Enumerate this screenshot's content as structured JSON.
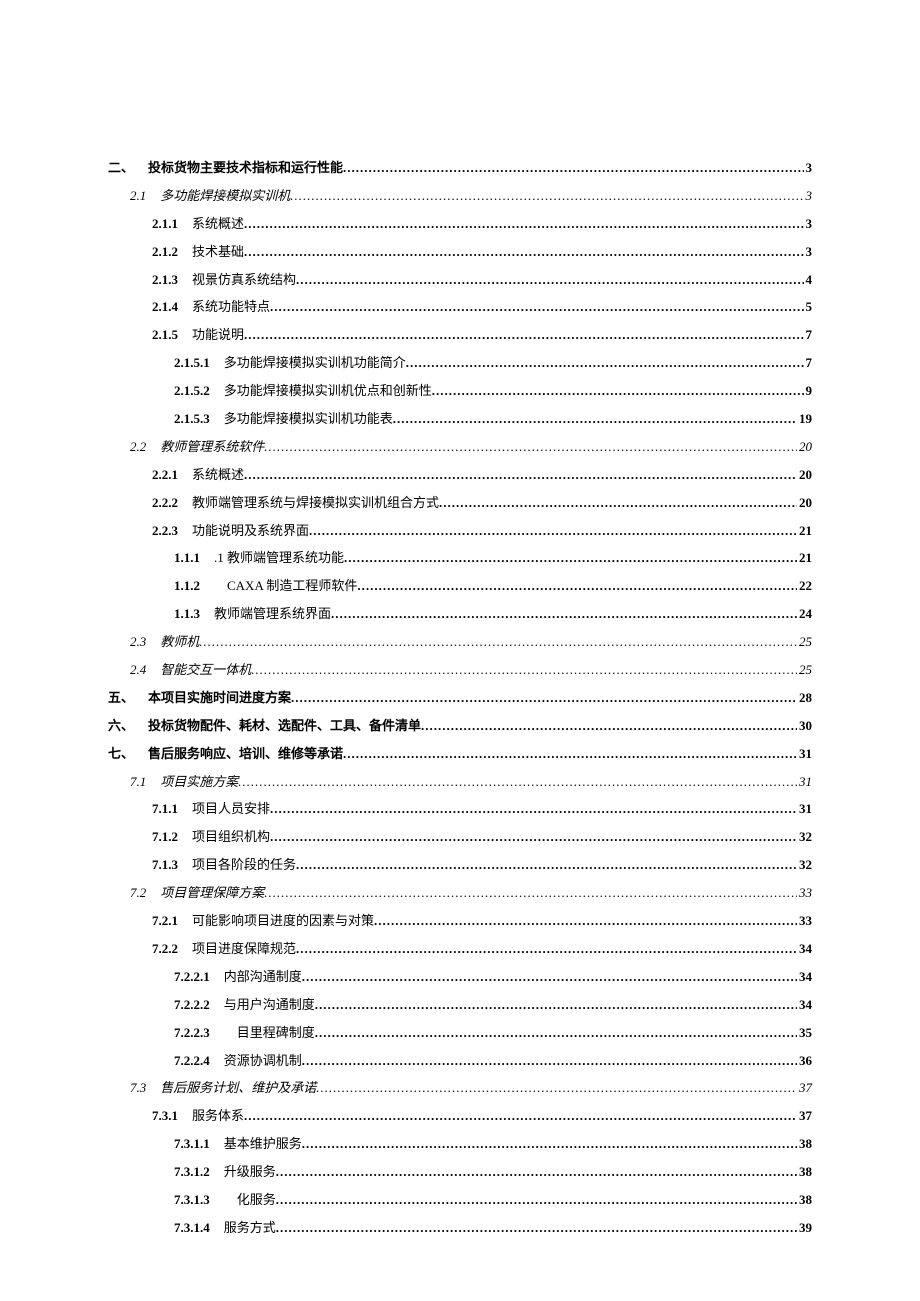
{
  "toc": [
    {
      "level": 0,
      "num": "二、",
      "title": "投标货物主要技术指标和运行性能",
      "page": "3"
    },
    {
      "level": 1,
      "num": "2.1",
      "title": "多功能焊接模拟实训机",
      "page": "3"
    },
    {
      "level": 2,
      "num": "2.1.1",
      "title": "系统概述",
      "page": "3"
    },
    {
      "level": 2,
      "num": "2.1.2",
      "title": "技术基础",
      "page": "3"
    },
    {
      "level": 2,
      "num": "2.1.3",
      "title": "视景仿真系统结构",
      "page": "4"
    },
    {
      "level": 2,
      "num": "2.1.4",
      "title": "系统功能特点",
      "page": "5"
    },
    {
      "level": 2,
      "num": "2.1.5",
      "title": "功能说明",
      "page": "7"
    },
    {
      "level": 3,
      "num": "2.1.5.1",
      "title": "多功能焊接模拟实训机功能简介",
      "page": "7"
    },
    {
      "level": 3,
      "num": "2.1.5.2",
      "title": "多功能焊接模拟实训机优点和创新性",
      "page": "9"
    },
    {
      "level": 3,
      "num": "2.1.5.3",
      "title": "多功能焊接模拟实训机功能表",
      "page": "19"
    },
    {
      "level": 1,
      "num": "2.2",
      "title": "教师管理系统软件",
      "page": "20"
    },
    {
      "level": 2,
      "num": "2.2.1",
      "title": "系统概述",
      "page": "20"
    },
    {
      "level": 2,
      "num": "2.2.2",
      "title": "教师端管理系统与焊接模拟实训机组合方式",
      "page": "20"
    },
    {
      "level": 2,
      "num": "2.2.3",
      "title": "功能说明及系统界面",
      "page": "21"
    },
    {
      "level": 3,
      "num": "1.1.1",
      "title": ".1 教师端管理系统功能",
      "page": "21"
    },
    {
      "level": 3,
      "num": "1.1.2",
      "title": "　CAXA 制造工程师软件",
      "page": "22"
    },
    {
      "level": 3,
      "num": "1.1.3",
      "title": "教师端管理系统界面",
      "page": "24"
    },
    {
      "level": 1,
      "num": "2.3",
      "title": "教师机",
      "page": "25"
    },
    {
      "level": 1,
      "num": "2.4",
      "title": "智能交互一体机",
      "page": "25"
    },
    {
      "level": 0,
      "num": "五、",
      "title": "本项目实施时间进度方案",
      "page": "28"
    },
    {
      "level": 0,
      "num": "六、",
      "title": "投标货物配件、耗材、选配件、工具、备件清单",
      "page": "30"
    },
    {
      "level": 0,
      "num": "七、",
      "title": "售后服务响应、培训、维修等承诺",
      "page": "31"
    },
    {
      "level": 1,
      "num": "7.1",
      "title": "项目实施方案",
      "page": "31"
    },
    {
      "level": 2,
      "num": "7.1.1",
      "title": "项目人员安排",
      "page": "31"
    },
    {
      "level": 2,
      "num": "7.1.2",
      "title": "项目组织机构",
      "page": "32"
    },
    {
      "level": 2,
      "num": "7.1.3",
      "title": "项目各阶段的任务",
      "page": "32"
    },
    {
      "level": 1,
      "num": "7.2",
      "title": "项目管理保障方案",
      "page": "33"
    },
    {
      "level": 2,
      "num": "7.2.1",
      "title": "可能影响项目进度的因素与对策",
      "page": "33"
    },
    {
      "level": 2,
      "num": "7.2.2",
      "title": "项目进度保障规范",
      "page": "34"
    },
    {
      "level": 3,
      "num": "7.2.2.1",
      "title": "内部沟通制度",
      "page": "34"
    },
    {
      "level": 3,
      "num": "7.2.2.2",
      "title": "与用户沟通制度",
      "page": "34"
    },
    {
      "level": 3,
      "num": "7.2.2.3",
      "title": "　目里程碑制度",
      "page": "35"
    },
    {
      "level": 3,
      "num": "7.2.2.4",
      "title": "资源协调机制",
      "page": "36"
    },
    {
      "level": 1,
      "num": "7.3",
      "title": "售后服务计划、维护及承诺",
      "page": "37"
    },
    {
      "level": 2,
      "num": "7.3.1",
      "title": "服务体系",
      "page": "37"
    },
    {
      "level": 3,
      "num": "7.3.1.1",
      "title": "基本维护服务",
      "page": "38"
    },
    {
      "level": 3,
      "num": "7.3.1.2",
      "title": "升级服务",
      "page": "38"
    },
    {
      "level": 3,
      "num": "7.3.1.3",
      "title": "　化服务",
      "page": "38"
    },
    {
      "level": 3,
      "num": "7.3.1.4",
      "title": "服务方式",
      "page": "39"
    }
  ]
}
